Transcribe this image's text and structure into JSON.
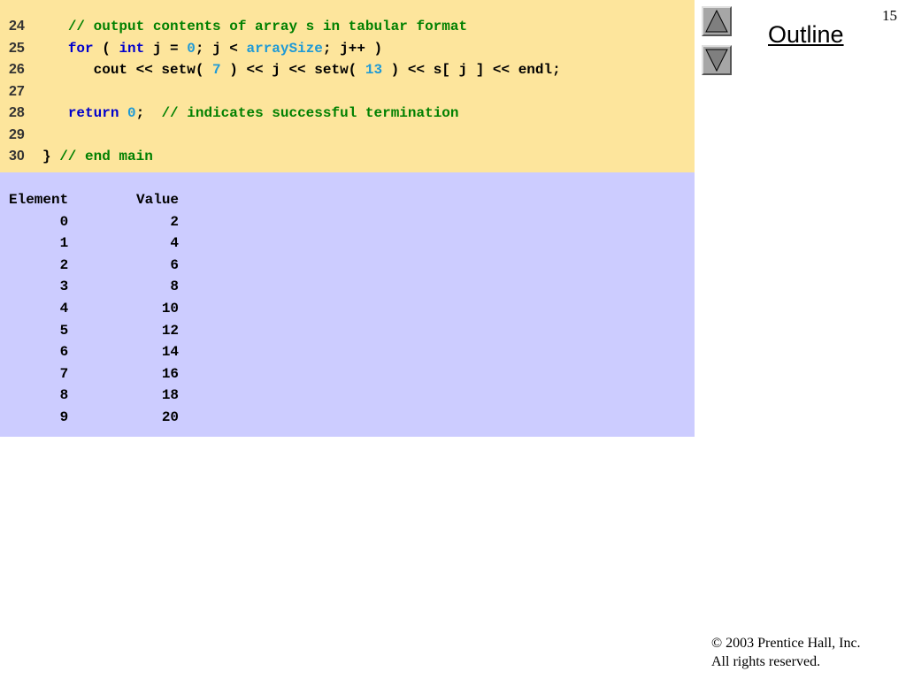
{
  "slide": {
    "page_number": "15",
    "outline_label": "Outline",
    "copyright_line1": "© 2003 Prentice Hall, Inc.",
    "copyright_line2": "All rights reserved."
  },
  "navigation": {
    "previous_icon": "up-triangle-icon",
    "next_icon": "down-triangle-icon"
  },
  "colors": {
    "code_background": "#fde59c",
    "output_background": "#ccccff",
    "comment": "#008000",
    "keyword": "#0000cc",
    "literal": "#1f9ad6"
  },
  "code_listing": [
    {
      "num": "24",
      "tokens": [
        {
          "t": "   ",
          "k": "plain"
        },
        {
          "t": "// output contents of array s in tabular format",
          "k": "comment"
        }
      ]
    },
    {
      "num": "25",
      "tokens": [
        {
          "t": "   ",
          "k": "plain"
        },
        {
          "t": "for",
          "k": "keyword"
        },
        {
          "t": " ( ",
          "k": "plain"
        },
        {
          "t": "int",
          "k": "keyword"
        },
        {
          "t": " j = ",
          "k": "plain"
        },
        {
          "t": "0",
          "k": "number"
        },
        {
          "t": "; j < ",
          "k": "plain"
        },
        {
          "t": "arraySize",
          "k": "ident"
        },
        {
          "t": "; j++ )",
          "k": "plain"
        }
      ]
    },
    {
      "num": "26",
      "tokens": [
        {
          "t": "      cout << setw( ",
          "k": "plain"
        },
        {
          "t": "7",
          "k": "number"
        },
        {
          "t": " ) << j << setw( ",
          "k": "plain"
        },
        {
          "t": "13",
          "k": "number"
        },
        {
          "t": " ) << s[ j ] << endl;",
          "k": "plain"
        }
      ]
    },
    {
      "num": "27",
      "tokens": []
    },
    {
      "num": "28",
      "tokens": [
        {
          "t": "   ",
          "k": "plain"
        },
        {
          "t": "return",
          "k": "keyword"
        },
        {
          "t": " ",
          "k": "plain"
        },
        {
          "t": "0",
          "k": "number"
        },
        {
          "t": ";  ",
          "k": "plain"
        },
        {
          "t": "// indicates successful termination",
          "k": "comment"
        }
      ]
    },
    {
      "num": "29",
      "tokens": []
    },
    {
      "num": "30",
      "tokens": [
        {
          "t": "} ",
          "k": "plain"
        },
        {
          "t": "// end main",
          "k": "comment"
        }
      ]
    }
  ],
  "program_output": {
    "header_element": "Element",
    "header_value": "Value",
    "rows": [
      {
        "element": "0",
        "value": "2"
      },
      {
        "element": "1",
        "value": "4"
      },
      {
        "element": "2",
        "value": "6"
      },
      {
        "element": "3",
        "value": "8"
      },
      {
        "element": "4",
        "value": "10"
      },
      {
        "element": "5",
        "value": "12"
      },
      {
        "element": "6",
        "value": "14"
      },
      {
        "element": "7",
        "value": "16"
      },
      {
        "element": "8",
        "value": "18"
      },
      {
        "element": "9",
        "value": "20"
      }
    ]
  }
}
